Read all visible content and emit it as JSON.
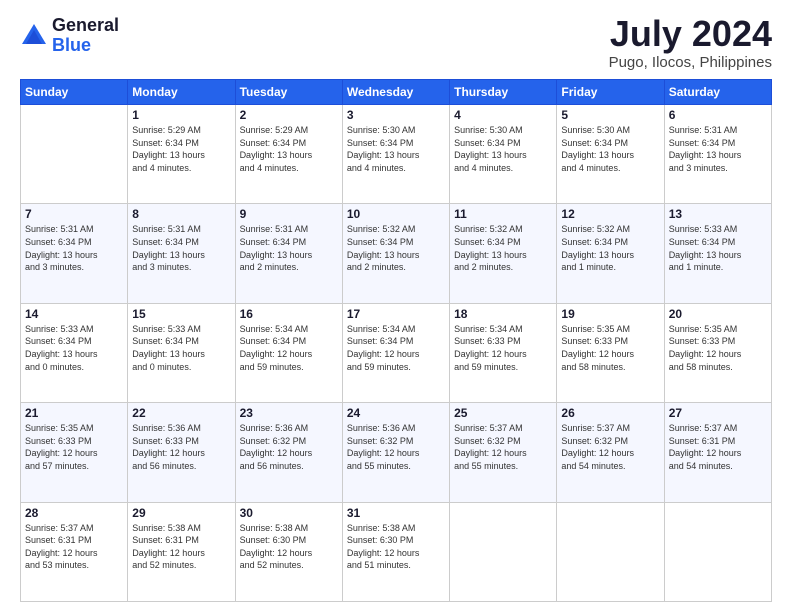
{
  "logo": {
    "general": "General",
    "blue": "Blue"
  },
  "title": "July 2024",
  "subtitle": "Pugo, Ilocos, Philippines",
  "days_header": [
    "Sunday",
    "Monday",
    "Tuesday",
    "Wednesday",
    "Thursday",
    "Friday",
    "Saturday"
  ],
  "weeks": [
    [
      {
        "num": "",
        "info": ""
      },
      {
        "num": "1",
        "info": "Sunrise: 5:29 AM\nSunset: 6:34 PM\nDaylight: 13 hours\nand 4 minutes."
      },
      {
        "num": "2",
        "info": "Sunrise: 5:29 AM\nSunset: 6:34 PM\nDaylight: 13 hours\nand 4 minutes."
      },
      {
        "num": "3",
        "info": "Sunrise: 5:30 AM\nSunset: 6:34 PM\nDaylight: 13 hours\nand 4 minutes."
      },
      {
        "num": "4",
        "info": "Sunrise: 5:30 AM\nSunset: 6:34 PM\nDaylight: 13 hours\nand 4 minutes."
      },
      {
        "num": "5",
        "info": "Sunrise: 5:30 AM\nSunset: 6:34 PM\nDaylight: 13 hours\nand 4 minutes."
      },
      {
        "num": "6",
        "info": "Sunrise: 5:31 AM\nSunset: 6:34 PM\nDaylight: 13 hours\nand 3 minutes."
      }
    ],
    [
      {
        "num": "7",
        "info": "Sunrise: 5:31 AM\nSunset: 6:34 PM\nDaylight: 13 hours\nand 3 minutes."
      },
      {
        "num": "8",
        "info": "Sunrise: 5:31 AM\nSunset: 6:34 PM\nDaylight: 13 hours\nand 3 minutes."
      },
      {
        "num": "9",
        "info": "Sunrise: 5:31 AM\nSunset: 6:34 PM\nDaylight: 13 hours\nand 2 minutes."
      },
      {
        "num": "10",
        "info": "Sunrise: 5:32 AM\nSunset: 6:34 PM\nDaylight: 13 hours\nand 2 minutes."
      },
      {
        "num": "11",
        "info": "Sunrise: 5:32 AM\nSunset: 6:34 PM\nDaylight: 13 hours\nand 2 minutes."
      },
      {
        "num": "12",
        "info": "Sunrise: 5:32 AM\nSunset: 6:34 PM\nDaylight: 13 hours\nand 1 minute."
      },
      {
        "num": "13",
        "info": "Sunrise: 5:33 AM\nSunset: 6:34 PM\nDaylight: 13 hours\nand 1 minute."
      }
    ],
    [
      {
        "num": "14",
        "info": "Sunrise: 5:33 AM\nSunset: 6:34 PM\nDaylight: 13 hours\nand 0 minutes."
      },
      {
        "num": "15",
        "info": "Sunrise: 5:33 AM\nSunset: 6:34 PM\nDaylight: 13 hours\nand 0 minutes."
      },
      {
        "num": "16",
        "info": "Sunrise: 5:34 AM\nSunset: 6:34 PM\nDaylight: 12 hours\nand 59 minutes."
      },
      {
        "num": "17",
        "info": "Sunrise: 5:34 AM\nSunset: 6:34 PM\nDaylight: 12 hours\nand 59 minutes."
      },
      {
        "num": "18",
        "info": "Sunrise: 5:34 AM\nSunset: 6:33 PM\nDaylight: 12 hours\nand 59 minutes."
      },
      {
        "num": "19",
        "info": "Sunrise: 5:35 AM\nSunset: 6:33 PM\nDaylight: 12 hours\nand 58 minutes."
      },
      {
        "num": "20",
        "info": "Sunrise: 5:35 AM\nSunset: 6:33 PM\nDaylight: 12 hours\nand 58 minutes."
      }
    ],
    [
      {
        "num": "21",
        "info": "Sunrise: 5:35 AM\nSunset: 6:33 PM\nDaylight: 12 hours\nand 57 minutes."
      },
      {
        "num": "22",
        "info": "Sunrise: 5:36 AM\nSunset: 6:33 PM\nDaylight: 12 hours\nand 56 minutes."
      },
      {
        "num": "23",
        "info": "Sunrise: 5:36 AM\nSunset: 6:32 PM\nDaylight: 12 hours\nand 56 minutes."
      },
      {
        "num": "24",
        "info": "Sunrise: 5:36 AM\nSunset: 6:32 PM\nDaylight: 12 hours\nand 55 minutes."
      },
      {
        "num": "25",
        "info": "Sunrise: 5:37 AM\nSunset: 6:32 PM\nDaylight: 12 hours\nand 55 minutes."
      },
      {
        "num": "26",
        "info": "Sunrise: 5:37 AM\nSunset: 6:32 PM\nDaylight: 12 hours\nand 54 minutes."
      },
      {
        "num": "27",
        "info": "Sunrise: 5:37 AM\nSunset: 6:31 PM\nDaylight: 12 hours\nand 54 minutes."
      }
    ],
    [
      {
        "num": "28",
        "info": "Sunrise: 5:37 AM\nSunset: 6:31 PM\nDaylight: 12 hours\nand 53 minutes."
      },
      {
        "num": "29",
        "info": "Sunrise: 5:38 AM\nSunset: 6:31 PM\nDaylight: 12 hours\nand 52 minutes."
      },
      {
        "num": "30",
        "info": "Sunrise: 5:38 AM\nSunset: 6:30 PM\nDaylight: 12 hours\nand 52 minutes."
      },
      {
        "num": "31",
        "info": "Sunrise: 5:38 AM\nSunset: 6:30 PM\nDaylight: 12 hours\nand 51 minutes."
      },
      {
        "num": "",
        "info": ""
      },
      {
        "num": "",
        "info": ""
      },
      {
        "num": "",
        "info": ""
      }
    ]
  ]
}
